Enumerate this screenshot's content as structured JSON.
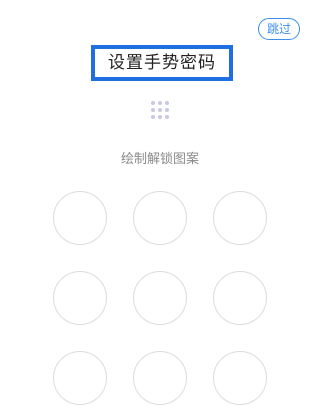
{
  "header": {
    "skip_label": "跳过",
    "title": "设置手势密码"
  },
  "preview": {
    "icon": "pattern-preview-icon",
    "dot_color": "#c9c8e6"
  },
  "hint": {
    "text": "绘制解锁图案"
  },
  "pattern": {
    "nodes": 9,
    "node_border_color": "#dcdcdc"
  },
  "colors": {
    "accent": "#3b8fe8",
    "highlight_border": "#1f6fe3",
    "hint_text": "#8a8a8a"
  }
}
